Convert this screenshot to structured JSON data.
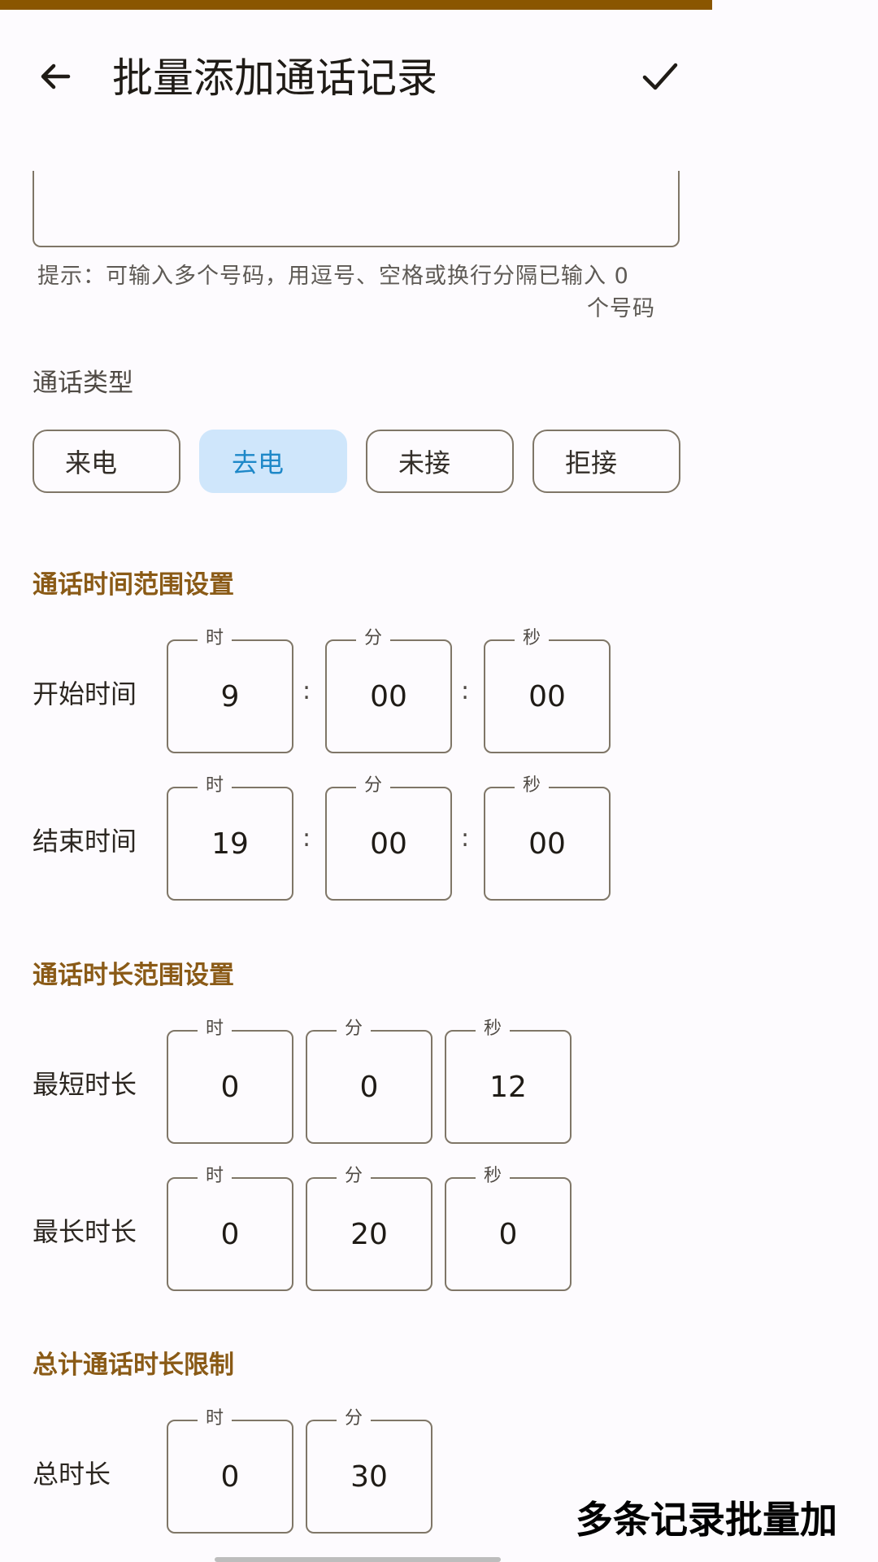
{
  "app_bar": {
    "title": "批量添加通话记录",
    "back_icon": "arrow-left-icon",
    "confirm_icon": "check-icon"
  },
  "phone_input": {
    "hint": "提示：可输入多个号码，用逗号、空格或换行分隔已输入 0",
    "hint_cont": "个号码"
  },
  "call_type": {
    "label": "通话类型",
    "options": [
      "来电",
      "去电",
      "未接",
      "拒接"
    ],
    "selected": "去电"
  },
  "time_range": {
    "title": "通话时间范围设置",
    "start": {
      "label": "开始时间",
      "hour": "9",
      "minute": "00",
      "second": "00"
    },
    "end": {
      "label": "结束时间",
      "hour": "19",
      "minute": "00",
      "second": "00"
    }
  },
  "duration_range": {
    "title": "通话时长范围设置",
    "min": {
      "label": "最短时长",
      "hour": "0",
      "minute": "0",
      "second": "12"
    },
    "max": {
      "label": "最长时长",
      "hour": "0",
      "minute": "20",
      "second": "0"
    }
  },
  "total_limit": {
    "title": "总计通话时长限制",
    "total": {
      "label": "总时长",
      "hour": "0",
      "minute": "30"
    }
  },
  "field_caps": {
    "hour": "时",
    "minute": "分",
    "second": "秒"
  },
  "colon": ":",
  "watermark": "多条记录批量加",
  "colors": {
    "accent": "#8a5600",
    "section_title": "#8a5a16",
    "selected_bg": "#cfe6fb",
    "selected_text": "#1e88c8",
    "outline": "#7f7667"
  }
}
